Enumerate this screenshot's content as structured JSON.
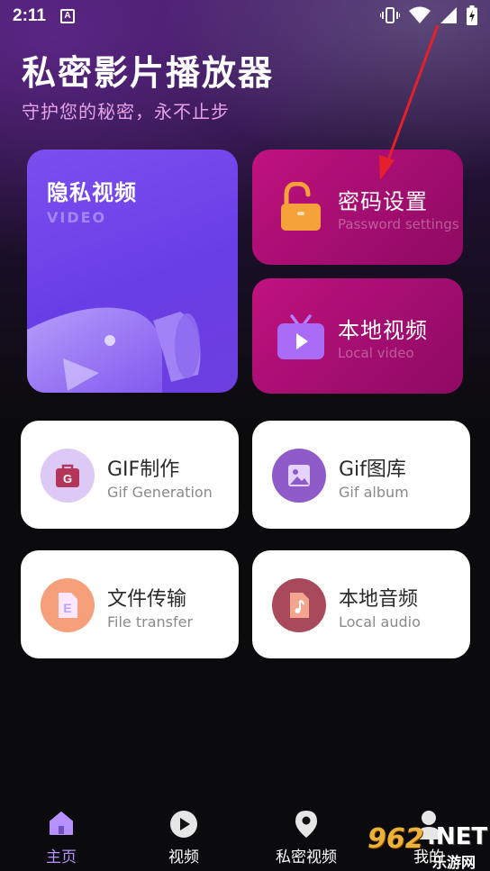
{
  "status_bar": {
    "time": "2:11",
    "a_icon": "A"
  },
  "header": {
    "title": "私密影片播放器",
    "subtitle": "守护您的秘密，永不止步"
  },
  "cards": {
    "privacy_video": {
      "label": "隐私视频",
      "en": "VIDEO"
    },
    "password_settings": {
      "label": "密码设置",
      "en": "Password settings"
    },
    "local_video": {
      "label": "本地视频",
      "en": "Local video"
    },
    "gif_generation": {
      "label": "GIF制作",
      "en": "Gif Generation",
      "icon_letter": "G"
    },
    "gif_album": {
      "label": "Gif图库",
      "en": "Gif album"
    },
    "file_transfer": {
      "label": "文件传输",
      "en": "File transfer",
      "icon_letter": "E"
    },
    "local_audio": {
      "label": "本地音频",
      "en": "Local audio"
    }
  },
  "bottom_nav": [
    {
      "label": "主页",
      "icon": "home-icon",
      "active": true
    },
    {
      "label": "视频",
      "icon": "play-icon",
      "active": false
    },
    {
      "label": "私密视频",
      "icon": "location-pin-icon",
      "active": false
    },
    {
      "label": "我的",
      "icon": "profile-icon",
      "active": false
    }
  ],
  "watermark": {
    "number": "962",
    "net": ".NET",
    "site": "乐游网"
  },
  "colors": {
    "accent_purple": "#b690ff",
    "card_purple": "#6d3fe0",
    "card_pink": "#a10d6f",
    "subtitle_pink": "#e5a3e6",
    "arrow_red": "#e5202b"
  }
}
